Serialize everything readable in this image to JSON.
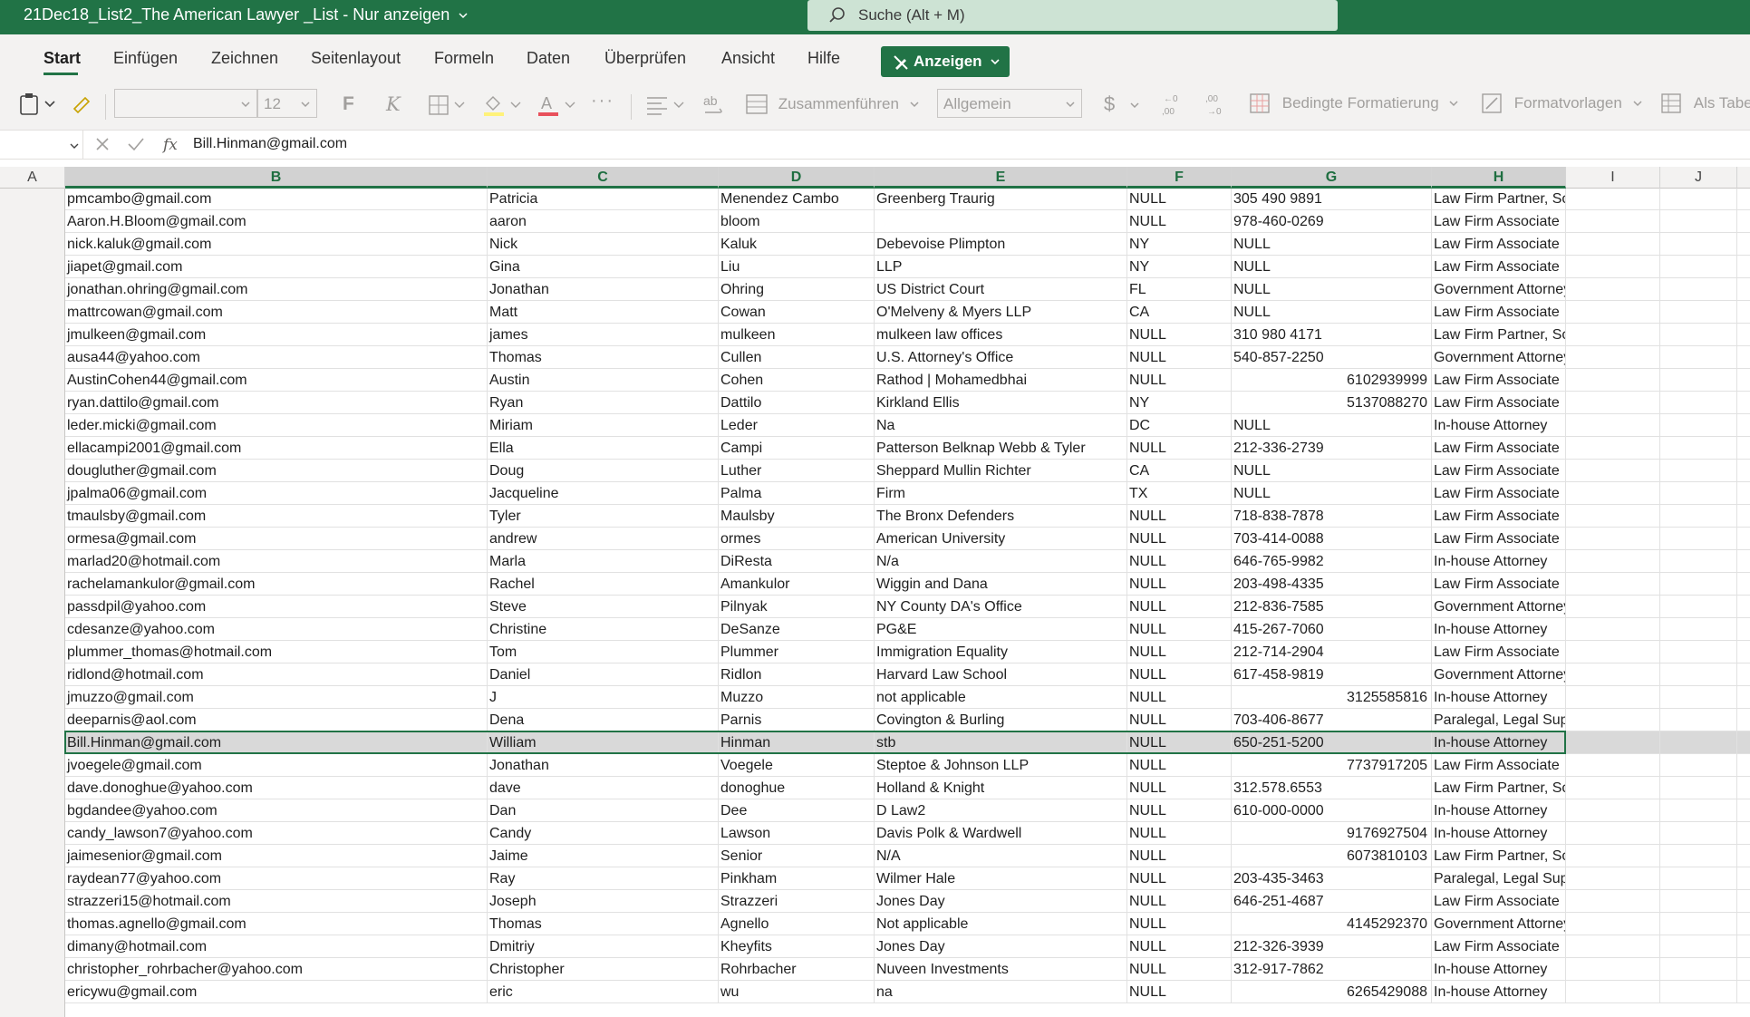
{
  "window": {
    "title": "21Dec18_List2_The American Lawyer _List  -  Nur anzeigen",
    "search_placeholder": "Suche (Alt + M)"
  },
  "ribbon": {
    "tabs": [
      "Start",
      "Einfügen",
      "Zeichnen",
      "Seitenlayout",
      "Formeln",
      "Daten",
      "Überprüfen",
      "Ansicht",
      "Hilfe"
    ],
    "active_tab": "Start",
    "view_mode_button": "Anzeigen"
  },
  "toolbar": {
    "font_name": "",
    "font_size": "12",
    "bold": "F",
    "italic": "K",
    "merge": "Zusammenführen",
    "number_format": "Allgemein",
    "currency": "$",
    "conditional_formatting": "Bedingte Formatierung",
    "format_templates": "Formatvorlagen",
    "as_table": "Als Tabe"
  },
  "formula_bar": {
    "name_box": "",
    "fx_label": "fx",
    "value": "Bill.Hinman@gmail.com"
  },
  "columns": [
    "A",
    "B",
    "C",
    "D",
    "E",
    "F",
    "G",
    "H",
    "I",
    "J"
  ],
  "selected_row_index": 24,
  "rows": [
    [
      "pmcambo@gmail.com",
      "Patricia",
      "Menendez Cambo",
      "Greenberg Traurig",
      "NULL",
      "305 490 9891",
      "Law Firm Partner, Solo Practit"
    ],
    [
      "Aaron.H.Bloom@gmail.com",
      "aaron",
      "bloom",
      "",
      "NULL",
      "978-460-0269",
      "Law Firm Associate"
    ],
    [
      "nick.kaluk@gmail.com",
      "Nick",
      "Kaluk",
      "Debevoise Plimpton",
      "NY",
      "NULL",
      "Law Firm Associate"
    ],
    [
      "jiapet@gmail.com",
      "Gina",
      "Liu",
      "LLP",
      "NY",
      "NULL",
      "Law Firm Associate"
    ],
    [
      "jonathan.ohring@gmail.com",
      "Jonathan",
      "Ohring",
      "US District Court",
      "FL",
      "NULL",
      "Government Attorney"
    ],
    [
      "mattrcowan@gmail.com",
      "Matt",
      "Cowan",
      "O'Melveny & Myers LLP",
      "CA",
      "NULL",
      "Law Firm Associate"
    ],
    [
      "jmulkeen@gmail.com",
      "james",
      "mulkeen",
      "mulkeen law offices",
      "NULL",
      "310 980 4171",
      "Law Firm Partner, Solo Practit"
    ],
    [
      "ausa44@yahoo.com",
      "Thomas",
      "Cullen",
      "U.S. Attorney's Office",
      "NULL",
      "540-857-2250",
      "Government Attorney"
    ],
    [
      "AustinCohen44@gmail.com",
      "Austin",
      "Cohen",
      "Rathod | Mohamedbhai",
      "NULL",
      "6102939999",
      "Law Firm Associate"
    ],
    [
      "ryan.dattilo@gmail.com",
      "Ryan",
      "Dattilo",
      "Kirkland Ellis",
      "NY",
      "5137088270",
      "Law Firm Associate"
    ],
    [
      "leder.micki@gmail.com",
      "Miriam",
      "Leder",
      "Na",
      "DC",
      "NULL",
      "In-house Attorney"
    ],
    [
      "ellacampi2001@gmail.com",
      "Ella",
      "Campi",
      "Patterson Belknap Webb & Tyler",
      "NULL",
      "212-336-2739",
      "Law Firm Associate"
    ],
    [
      "dougluther@gmail.com",
      "Doug",
      "Luther",
      "Sheppard Mullin Richter",
      "CA",
      "NULL",
      "Law Firm Associate"
    ],
    [
      "jpalma06@gmail.com",
      "Jacqueline",
      "Palma",
      "Firm",
      "TX",
      "NULL",
      "Law Firm Associate"
    ],
    [
      "tmaulsby@gmail.com",
      "Tyler",
      "Maulsby",
      "The Bronx Defenders",
      "NULL",
      "718-838-7878",
      "Law Firm Associate"
    ],
    [
      "ormesa@gmail.com",
      "andrew",
      "ormes",
      "American University",
      "NULL",
      "703-414-0088",
      "Law Firm Associate"
    ],
    [
      "marlad20@hotmail.com",
      "Marla",
      "DiResta",
      "N/a",
      "NULL",
      "646-765-9982",
      "In-house Attorney"
    ],
    [
      "rachelamankulor@gmail.com",
      "Rachel",
      "Amankulor",
      "Wiggin and Dana",
      "NULL",
      "203-498-4335",
      "Law Firm Associate"
    ],
    [
      "passdpil@yahoo.com",
      "Steve",
      "Pilnyak",
      "NY County DA's Office",
      "NULL",
      "212-836-7585",
      "Government Attorney"
    ],
    [
      "cdesanze@yahoo.com",
      "Christine",
      "DeSanze",
      "PG&E",
      "NULL",
      "415-267-7060",
      "In-house Attorney"
    ],
    [
      "plummer_thomas@hotmail.com",
      "Tom",
      "Plummer",
      "Immigration Equality",
      "NULL",
      "212-714-2904",
      "Law Firm Associate"
    ],
    [
      "ridlond@hotmail.com",
      "Daniel",
      "Ridlon",
      "Harvard Law School",
      "NULL",
      "617-458-9819",
      "Government Attorney"
    ],
    [
      "jmuzzo@gmail.com",
      "J",
      "Muzzo",
      "not applicable",
      "NULL",
      "3125585816",
      "In-house Attorney"
    ],
    [
      "deeparnis@aol.com",
      "Dena",
      "Parnis",
      "Covington & Burling",
      "NULL",
      "703-406-8677",
      "Paralegal, Legal Support"
    ],
    [
      "Bill.Hinman@gmail.com",
      "William",
      "Hinman",
      "stb",
      "NULL",
      "650-251-5200",
      "In-house Attorney"
    ],
    [
      "jvoegele@gmail.com",
      "Jonathan",
      "Voegele",
      "Steptoe & Johnson LLP",
      "NULL",
      "7737917205",
      "Law Firm Associate"
    ],
    [
      "dave.donoghue@yahoo.com",
      "dave",
      "donoghue",
      "Holland & Knight",
      "NULL",
      "312.578.6553",
      "Law Firm Partner, Solo Practit"
    ],
    [
      "bgdandee@yahoo.com",
      "Dan",
      "Dee",
      "D Law2",
      "NULL",
      "610-000-0000",
      "In-house Attorney"
    ],
    [
      "candy_lawson7@yahoo.com",
      "Candy",
      "Lawson",
      "Davis Polk & Wardwell",
      "NULL",
      "9176927504",
      "In-house Attorney"
    ],
    [
      "jaimesenior@gmail.com",
      "Jaime",
      "Senior",
      "N/A",
      "NULL",
      "6073810103",
      "Law Firm Partner, Solo Practit"
    ],
    [
      "raydean77@yahoo.com",
      "Ray",
      "Pinkham",
      "Wilmer Hale",
      "NULL",
      "203-435-3463",
      "Paralegal, Legal Support"
    ],
    [
      "strazzeri15@hotmail.com",
      "Joseph",
      "Strazzeri",
      "Jones Day",
      "NULL",
      "646-251-4687",
      "Law Firm Associate"
    ],
    [
      "thomas.agnello@gmail.com",
      "Thomas",
      "Agnello",
      "Not applicable",
      "NULL",
      "4145292370",
      "Government Attorney"
    ],
    [
      "dimany@hotmail.com",
      "Dmitriy",
      "Kheyfits",
      "Jones Day",
      "NULL",
      "212-326-3939",
      "Law Firm Associate"
    ],
    [
      "christopher_rohrbacher@yahoo.com",
      "Christopher",
      "Rohrbacher",
      "Nuveen Investments",
      "NULL",
      "312-917-7862",
      "In-house Attorney"
    ],
    [
      "ericywu@gmail.com",
      "eric",
      "wu",
      "na",
      "NULL",
      "6265429088",
      "In-house Attorney"
    ]
  ],
  "colors": {
    "brand": "#217346",
    "search": "#cde3d4",
    "selection": "#d9d9d9"
  }
}
